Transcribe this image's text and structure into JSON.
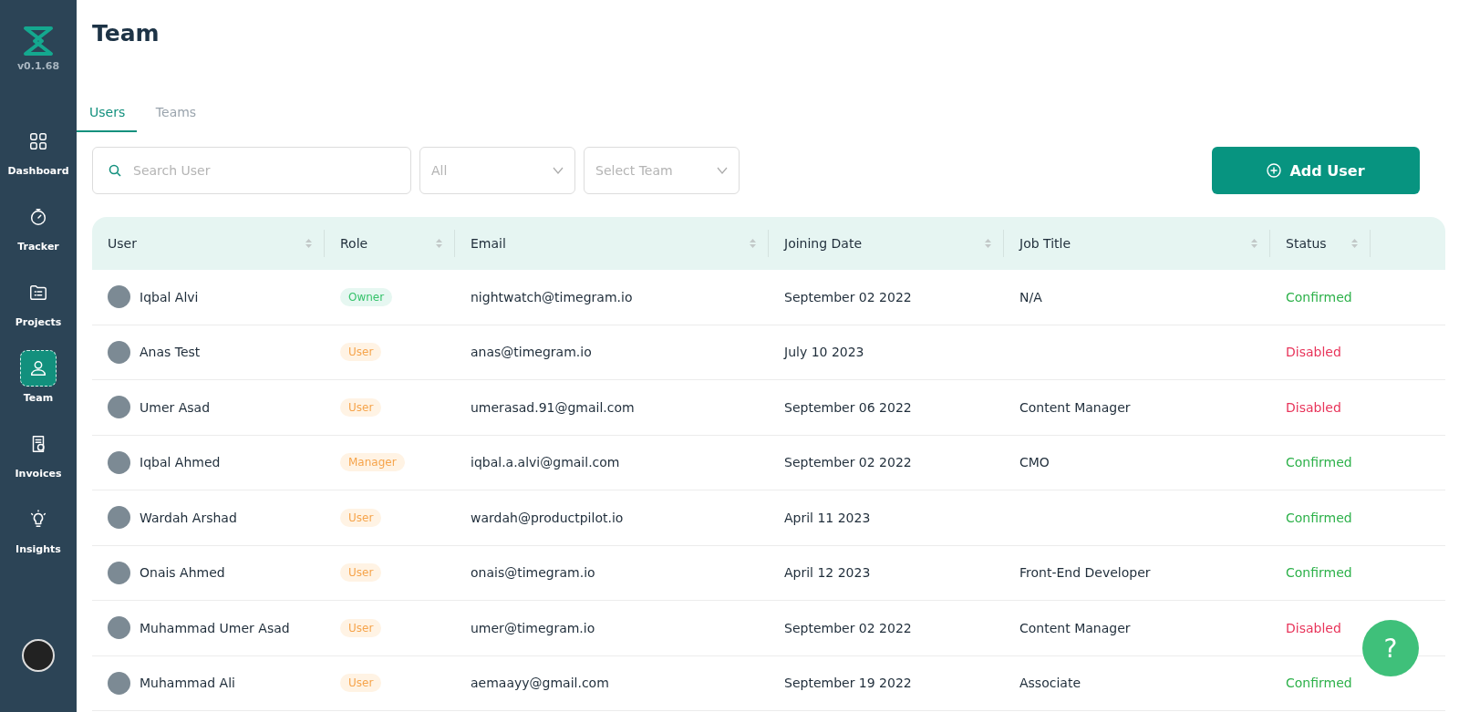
{
  "sidebar": {
    "version": "v0.1.68",
    "items": [
      {
        "label": "Dashboard",
        "selected": false
      },
      {
        "label": "Tracker",
        "selected": false
      },
      {
        "label": "Projects",
        "selected": false
      },
      {
        "label": "Team",
        "selected": true
      },
      {
        "label": "Invoices",
        "selected": false
      },
      {
        "label": "Insights",
        "selected": false
      }
    ]
  },
  "page": {
    "title": "Team"
  },
  "tabs": [
    {
      "label": "Users",
      "selected": true
    },
    {
      "label": "Teams",
      "selected": false
    }
  ],
  "filters": {
    "search": {
      "placeholder": "Search User"
    },
    "role": {
      "placeholder": "All"
    },
    "team": {
      "placeholder": "Select Team"
    },
    "add_button": "Add User"
  },
  "table": {
    "columns": [
      "User",
      "Role",
      "Email",
      "Joining Date",
      "Job Title",
      "Status"
    ],
    "rows": [
      {
        "user": "Iqbal Alvi",
        "role": {
          "label": "Owner",
          "kind": "owner"
        },
        "email": "nightwatch@timegram.io",
        "joining_date": "September 02 2022",
        "job_title": "N/A",
        "status": {
          "label": "Confirmed",
          "kind": "confirmed"
        }
      },
      {
        "user": "Anas Test",
        "role": {
          "label": "User",
          "kind": "user"
        },
        "email": "anas@timegram.io",
        "joining_date": "July 10 2023",
        "status": {
          "label": "Disabled",
          "kind": "disabled"
        }
      },
      {
        "user": "Umer Asad",
        "role": {
          "label": "User",
          "kind": "user"
        },
        "email": "umerasad.91@gmail.com",
        "joining_date": "September 06 2022",
        "job_title": "Content Manager",
        "status": {
          "label": "Disabled",
          "kind": "disabled"
        }
      },
      {
        "user": "Iqbal Ahmed",
        "role": {
          "label": "Manager",
          "kind": "manager"
        },
        "email": "iqbal.a.alvi@gmail.com",
        "joining_date": "September 02 2022",
        "job_title": "CMO",
        "status": {
          "label": "Confirmed",
          "kind": "confirmed"
        }
      },
      {
        "user": "Wardah Arshad",
        "role": {
          "label": "User",
          "kind": "user"
        },
        "email": "wardah@productpilot.io",
        "joining_date": "April 11 2023",
        "status": {
          "label": "Confirmed",
          "kind": "confirmed"
        }
      },
      {
        "user": "Onais Ahmed",
        "role": {
          "label": "User",
          "kind": "user"
        },
        "email": "onais@timegram.io",
        "joining_date": "April 12 2023",
        "job_title": "Front-End Developer",
        "status": {
          "label": "Confirmed",
          "kind": "confirmed"
        }
      },
      {
        "user": "Muhammad Umer Asad",
        "role": {
          "label": "User",
          "kind": "user"
        },
        "email": "umer@timegram.io",
        "joining_date": "September 02 2022",
        "job_title": "Content Manager",
        "status": {
          "label": "Disabled",
          "kind": "disabled"
        }
      },
      {
        "user": "Muhammad Ali",
        "role": {
          "label": "User",
          "kind": "user"
        },
        "email": "aemaayy@gmail.com",
        "joining_date": "September 19 2022",
        "job_title": "Associate",
        "status": {
          "label": "Confirmed",
          "kind": "confirmed"
        }
      }
    ]
  },
  "help_button": "?"
}
